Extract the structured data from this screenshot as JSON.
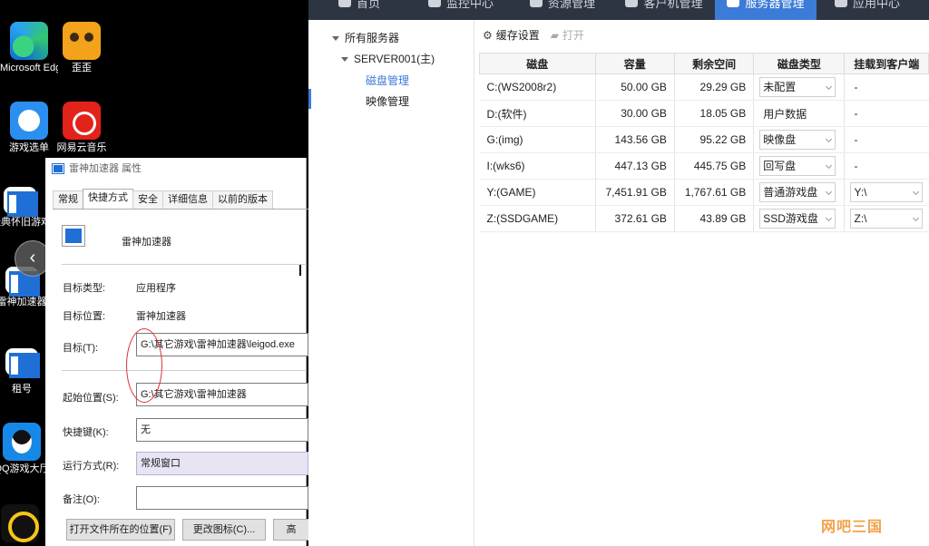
{
  "desktop": {
    "icons": [
      {
        "label": "Microsoft Edge",
        "icon": "edge-icon"
      },
      {
        "label": "歪歪",
        "icon": "panda-icon"
      },
      {
        "label": "游戏选单",
        "icon": "game-menu-icon"
      },
      {
        "label": "网易云音乐",
        "icon": "netease-music-icon"
      },
      {
        "label": "经典怀旧游戏菜单",
        "icon": "shortcut-icon"
      },
      {
        "label": "雷神加速器",
        "icon": "shortcut-icon"
      },
      {
        "label": "租号",
        "icon": "shortcut-icon"
      },
      {
        "label": "QQ游戏大厅",
        "icon": "qq-game-icon"
      }
    ]
  },
  "dialog": {
    "title": "雷神加速器 属性",
    "tabs": [
      "常规",
      "快捷方式",
      "安全",
      "详细信息",
      "以前的版本"
    ],
    "app_name": "雷神加速器",
    "target_type_label": "目标类型:",
    "target_type_value": "应用程序",
    "target_location_label": "目标位置:",
    "target_location_value": "雷神加速器",
    "target_label": "目标(T):",
    "target_value": "G:\\其它游戏\\雷神加速器\\leigod.exe",
    "start_in_label": "起始位置(S):",
    "start_in_value": "G:\\其它游戏\\雷神加速器",
    "hotkey_label": "快捷键(K):",
    "hotkey_value": "无",
    "run_label": "运行方式(R):",
    "run_value": "常规窗口",
    "comment_label": "备注(O):",
    "comment_value": "",
    "buttons": [
      "打开文件所在的位置(F)",
      "更改图标(C)...",
      "高"
    ]
  },
  "app": {
    "nav": [
      "首页",
      "监控中心",
      "资源管理",
      "客户机管理",
      "服务器管理",
      "应用中心"
    ],
    "active_nav": "服务器管理",
    "tree": {
      "root": "所有服务器",
      "server": "SERVER001(主)",
      "items": [
        "磁盘管理",
        "映像管理"
      ]
    },
    "toolbar": {
      "cache": "缓存设置",
      "open": "打开"
    },
    "table": {
      "headers": [
        "磁盘",
        "容量",
        "剩余空间",
        "磁盘类型",
        "挂载到客户端"
      ],
      "rows": [
        {
          "disk": "C:(WS2008r2)",
          "capacity": "50.00 GB",
          "free": "29.29 GB",
          "type": "未配置",
          "type_dropdown": true,
          "mount": "-",
          "mount_dropdown": false
        },
        {
          "disk": "D:(软件)",
          "capacity": "30.00 GB",
          "free": "18.05 GB",
          "type": "用户数据",
          "type_dropdown": false,
          "mount": "-",
          "mount_dropdown": false
        },
        {
          "disk": "G:(img)",
          "capacity": "143.56 GB",
          "free": "95.22 GB",
          "type": "映像盘",
          "type_dropdown": true,
          "mount": "-",
          "mount_dropdown": false
        },
        {
          "disk": "I:(wks6)",
          "capacity": "447.13 GB",
          "free": "445.75 GB",
          "type": "回写盘",
          "type_dropdown": true,
          "mount": "-",
          "mount_dropdown": false
        },
        {
          "disk": "Y:(GAME)",
          "capacity": "7,451.91 GB",
          "free": "1,767.61 GB",
          "type": "普通游戏盘",
          "type_dropdown": true,
          "mount": "Y:\\",
          "mount_dropdown": true
        },
        {
          "disk": "Z:(SSDGAME)",
          "capacity": "372.61 GB",
          "free": "43.89 GB",
          "type": "SSD游戏盘",
          "type_dropdown": true,
          "mount": "Z:\\",
          "mount_dropdown": true
        }
      ]
    }
  },
  "watermark": "网吧三国"
}
